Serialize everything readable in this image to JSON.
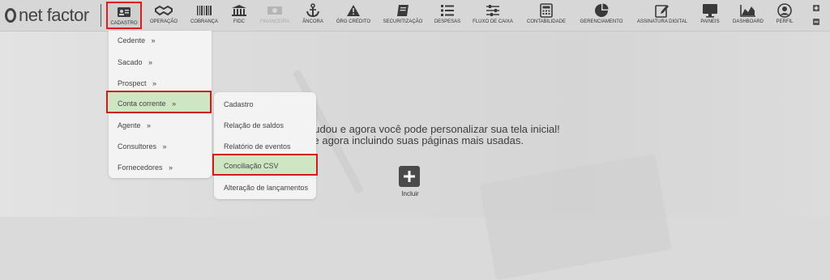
{
  "brand": {
    "logo_text": "net factor"
  },
  "nav": {
    "items": [
      {
        "id": "cadastro",
        "label": "CADASTRO",
        "icon": "id-card-icon"
      },
      {
        "id": "operacao",
        "label": "OPERAÇÃO",
        "icon": "handshake-icon"
      },
      {
        "id": "cobranca",
        "label": "COBRANÇA",
        "icon": "barcode-icon"
      },
      {
        "id": "fidc",
        "label": "FIDC",
        "icon": "bank-icon"
      },
      {
        "id": "financeira",
        "label": "FINANCEIRA",
        "icon": "banknote-icon"
      },
      {
        "id": "ancora",
        "label": "ÂNCORA",
        "icon": "anchor-icon"
      },
      {
        "id": "org-credito",
        "label": "ÓRG CRÉDITO",
        "icon": "warning-icon"
      },
      {
        "id": "securitizacao",
        "label": "SECURITIZAÇÃO",
        "icon": "book-icon"
      },
      {
        "id": "despesas",
        "label": "DESPESAS",
        "icon": "list-icon"
      },
      {
        "id": "fluxo-de-caixa",
        "label": "FLUXO DE CAIXA",
        "icon": "sliders-icon"
      },
      {
        "id": "contabilidade",
        "label": "CONTABILIDADE",
        "icon": "calculator-icon"
      },
      {
        "id": "gerenciamento",
        "label": "GERENCIAMENTO",
        "icon": "pie-chart-icon"
      },
      {
        "id": "assinatura-digital",
        "label": "ASSINATURA DIGITAL",
        "icon": "edit-icon"
      },
      {
        "id": "paineis",
        "label": "PAINEIS",
        "icon": "monitor-icon"
      },
      {
        "id": "dashboard",
        "label": "DASHBOARD",
        "icon": "area-chart-icon"
      },
      {
        "id": "perfil",
        "label": "PERFIL",
        "icon": "user-icon"
      }
    ]
  },
  "cadastro_menu": {
    "items": [
      {
        "label": "Cedente",
        "arrow": "»"
      },
      {
        "label": "Sacado",
        "arrow": "»"
      },
      {
        "label": "Prospect",
        "arrow": "»"
      },
      {
        "label": "Conta corrente",
        "arrow": "»"
      },
      {
        "label": "Agente",
        "arrow": "»"
      },
      {
        "label": "Consultores",
        "arrow": "»"
      },
      {
        "label": "Fornecedores",
        "arrow": "»"
      }
    ]
  },
  "conta_corrente_menu": {
    "items": [
      {
        "label": "Cadastro"
      },
      {
        "label": "Relação de saldos"
      },
      {
        "label": "Relatório de eventos"
      },
      {
        "label": "Conciliação CSV"
      },
      {
        "label": "Alteração de lançamentos"
      }
    ]
  },
  "welcome": {
    "line1": "nudou e agora você pode personalizar sua tela inicial!",
    "line2": "ce agora incluindo suas páginas mais usadas."
  },
  "add": {
    "label": "Incluir"
  },
  "window_controls": {
    "plus": "+",
    "minus": "−"
  },
  "colors": {
    "highlight_border": "#d11b1b",
    "highlight_fill": "#cfe6c3",
    "icon": "#3a3a3a"
  }
}
